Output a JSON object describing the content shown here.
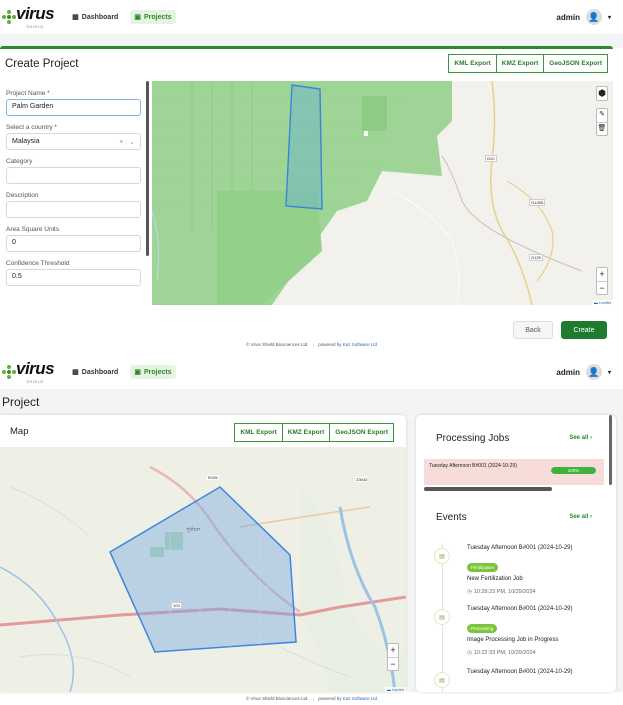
{
  "nav_top": {
    "logo_text": "virus",
    "logo_sub": "SHIELD",
    "links": [
      {
        "label": "Dashboard",
        "icon": "grid-icon"
      },
      {
        "label": "Projects",
        "icon": "folder-icon"
      }
    ],
    "user": "admin"
  },
  "create": {
    "title": "Create Project",
    "exports": [
      "KML Export",
      "KMZ Export",
      "GeoJSON Export"
    ],
    "fields": {
      "project_name_label": "Project Name *",
      "project_name_value": "Palm Garden",
      "country_label": "Select a country *",
      "country_value": "Malaysia",
      "clear_symbol": "×",
      "category_label": "Category",
      "category_value": "",
      "description_label": "Description",
      "description_value": "",
      "area_label": "Area Square Units",
      "area_value": "0",
      "confidence_label": "Confidence Threshold",
      "confidence_value": "0.5"
    },
    "map_labels": {
      "road1": "G20",
      "road2": "G128S",
      "road3": "G125"
    },
    "back_label": "Back",
    "create_label": "Create",
    "leaflet": "Leaflet"
  },
  "footer": {
    "left": "© Virus Shield Biosciences Ltd.",
    "sep": "|",
    "powered": "powered by",
    "company": "Kaz Software Ltd"
  },
  "project": {
    "title": "Project",
    "map_title": "Map",
    "exports": [
      "KML Export",
      "KMZ Export",
      "GeoJSON Export"
    ],
    "map_labels": {
      "r1": "R105",
      "r2": "Z3043",
      "r3": "103",
      "place": "পূর্বাচল"
    },
    "leaflet": "Leaflet",
    "jobs": {
      "title": "Processing Jobs",
      "see_all": "See all ›",
      "items": [
        {
          "name": "Tuesday Afternoon B#001 (2024-10-29)",
          "progress": 100,
          "progress_label": "100%"
        }
      ]
    },
    "events": {
      "title": "Events",
      "see_all": "See all ›",
      "items": [
        {
          "title": "Tuesday Afternoon B#001 (2024-10-29)",
          "badge": "Fertilization",
          "desc": "New Fertilization Job",
          "time": "10:28:23 PM, 10/29/2024"
        },
        {
          "title": "Tuesday Afternoon B#001 (2024-10-29)",
          "badge": "Processing",
          "desc": "Image Processing Job in Progress",
          "time": "10:22:33 PM, 10/29/2024"
        },
        {
          "title": "Tuesday Afternoon B#001 (2024-10-29)",
          "badge": "",
          "desc": "",
          "time": ""
        }
      ]
    }
  },
  "colors": {
    "brand_green": "#2a8a2a",
    "polygon_blue": "#4a90e2",
    "land_green": "#8fd68a",
    "progress_green": "#3db33d",
    "badge_green": "#7cc43a"
  }
}
